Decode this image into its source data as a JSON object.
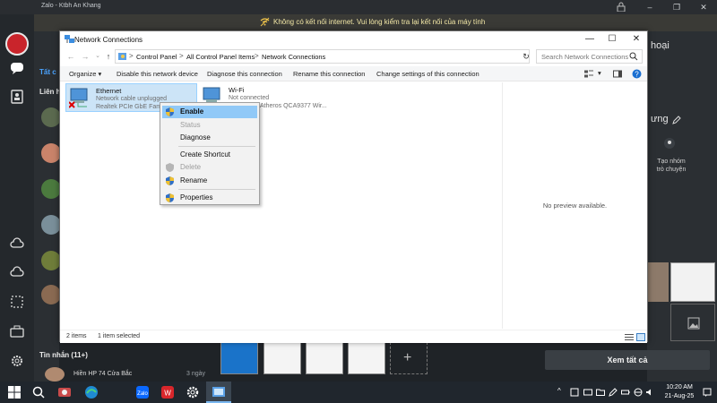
{
  "zalo": {
    "window_title": "Zalo - Ktbh An Khang",
    "banner_text": "Không có kết nối internet. Vui lòng kiểm tra lại kết nối của máy tính",
    "conv_section_1": "Liên h",
    "conv_section_2": "Tất c",
    "right_label_1": "hoại",
    "right_label_2": "ưng",
    "create_group_line1": "Tạo nhóm",
    "create_group_line2": "trò chuyện",
    "messages_header": "Tin nhắn (11+)",
    "chat_name": "Hiền HP 74 Cửa Bắc",
    "chat_time": "3 ngày",
    "view_all": "Xem tất cả"
  },
  "window": {
    "title": "Network Connections",
    "minimize": "—",
    "maximize": "☐",
    "close": "✕"
  },
  "address": {
    "crumbs": [
      "Control Panel",
      "All Control Panel Items",
      "Network Connections"
    ],
    "separator": ">",
    "search_placeholder": "Search Network Connections"
  },
  "commands": {
    "organize": "Organize ▾",
    "disable": "Disable this network device",
    "diagnose": "Diagnose this connection",
    "rename": "Rename this connection",
    "change": "Change settings of this connection"
  },
  "items": [
    {
      "name": "Ethernet",
      "status": "Network cable unplugged",
      "adapter": "Realtek PCIe GbE Famil"
    },
    {
      "name": "Wi-Fi",
      "status": "Not connected",
      "adapter": "Atheros QCA9377 Wir..."
    }
  ],
  "preview": {
    "text": "No preview available."
  },
  "statusbar": {
    "count": "2 items",
    "selected": "1 item selected"
  },
  "context_menu": {
    "enable": "Enable",
    "status": "Status",
    "diagnose": "Diagnose",
    "create_shortcut": "Create Shortcut",
    "delete": "Delete",
    "rename": "Rename",
    "properties": "Properties"
  },
  "taskbar": {
    "time": "10:20 AM",
    "date": "21-Aug-25"
  },
  "colors": {
    "selection": "#cce4f7",
    "menu_highlight": "#91c9f7",
    "banner_text": "#f2e7a6",
    "taskbar": "#20262d"
  }
}
